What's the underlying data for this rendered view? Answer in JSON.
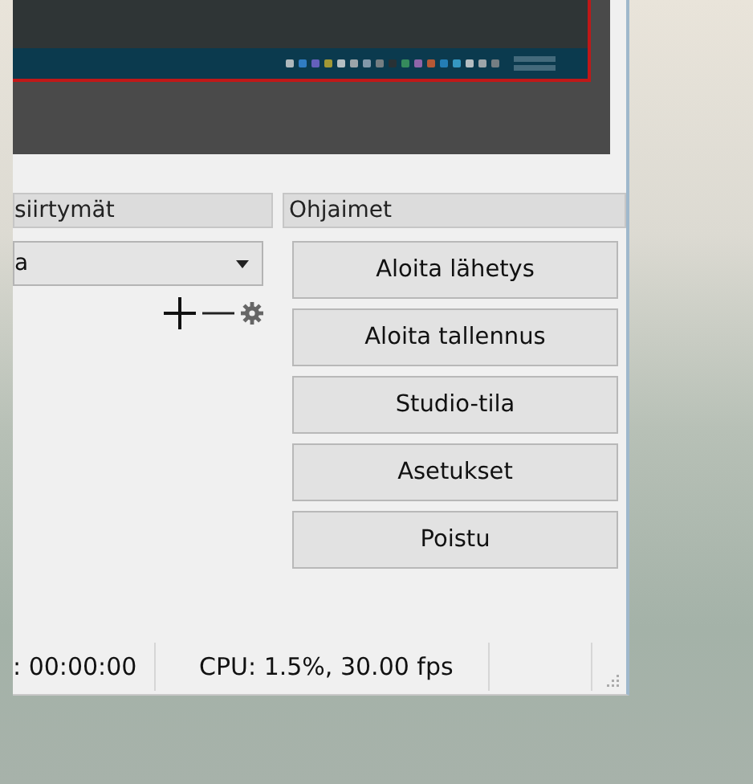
{
  "transitions_dock": {
    "title": "siirtymät",
    "dropdown_value": "a"
  },
  "controls_dock": {
    "title": "Ohjaimet",
    "buttons": [
      "Aloita lähetys",
      "Aloita tallennus",
      "Studio-tila",
      "Asetukset",
      "Poistu"
    ]
  },
  "status_bar": {
    "items": [
      ": 00:00:00",
      "CPU: 1.5%, 30.00 fps"
    ]
  }
}
